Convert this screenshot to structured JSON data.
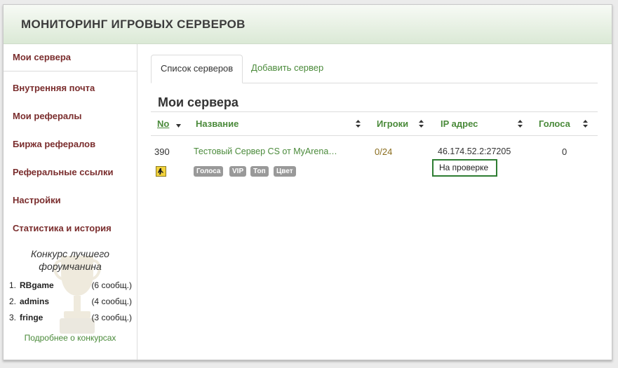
{
  "header": {
    "title": "МОНИТОРИНГ ИГРОВЫХ СЕРВЕРОВ"
  },
  "sidebar": {
    "items": [
      {
        "label": "Мои сервера"
      },
      {
        "label": "Внутренняя почта"
      },
      {
        "label": "Мои рефералы"
      },
      {
        "label": "Биржа рефералов"
      },
      {
        "label": "Реферальные ссылки"
      },
      {
        "label": "Настройки"
      },
      {
        "label": "Статистика и история"
      }
    ],
    "contest": {
      "title_line1": "Конкурс лучшего",
      "title_line2": "форумчанина",
      "rows": [
        {
          "num": "1.",
          "name": "RBgame",
          "count": "(6 сообщ.)"
        },
        {
          "num": "2.",
          "name": "admins",
          "count": "(4 сообщ.)"
        },
        {
          "num": "3.",
          "name": "fringe",
          "count": "(3 сообщ.)"
        }
      ],
      "link": "Подробнее о конкурсах"
    }
  },
  "tabs": [
    {
      "label": "Список серверов"
    },
    {
      "label": "Добавить сервер"
    }
  ],
  "main": {
    "section_title": "Мои сервера",
    "columns": {
      "no": "No",
      "name": "Название",
      "players": "Игроки",
      "ip": "IP адрес",
      "votes": "Голоса"
    },
    "rows": [
      {
        "no": "390",
        "name": "Тестовый Сервер CS от MyArena…",
        "players": "0/24",
        "ip": "46.174.52.2:27205",
        "votes": "0",
        "status": "На проверке",
        "badges": [
          "Голоса",
          "VIP",
          "Топ",
          "Цвет"
        ]
      }
    ]
  },
  "colors": {
    "nav_text": "#7a2d2d",
    "link_green": "#4a8a3a",
    "status_border": "#2e7d32",
    "badge_gray": "#999999"
  },
  "icons": {
    "sort": "sort-arrows-icon",
    "sort_desc": "sort-desc-icon",
    "game": "counter-strike-icon",
    "trophy": "trophy-icon"
  }
}
